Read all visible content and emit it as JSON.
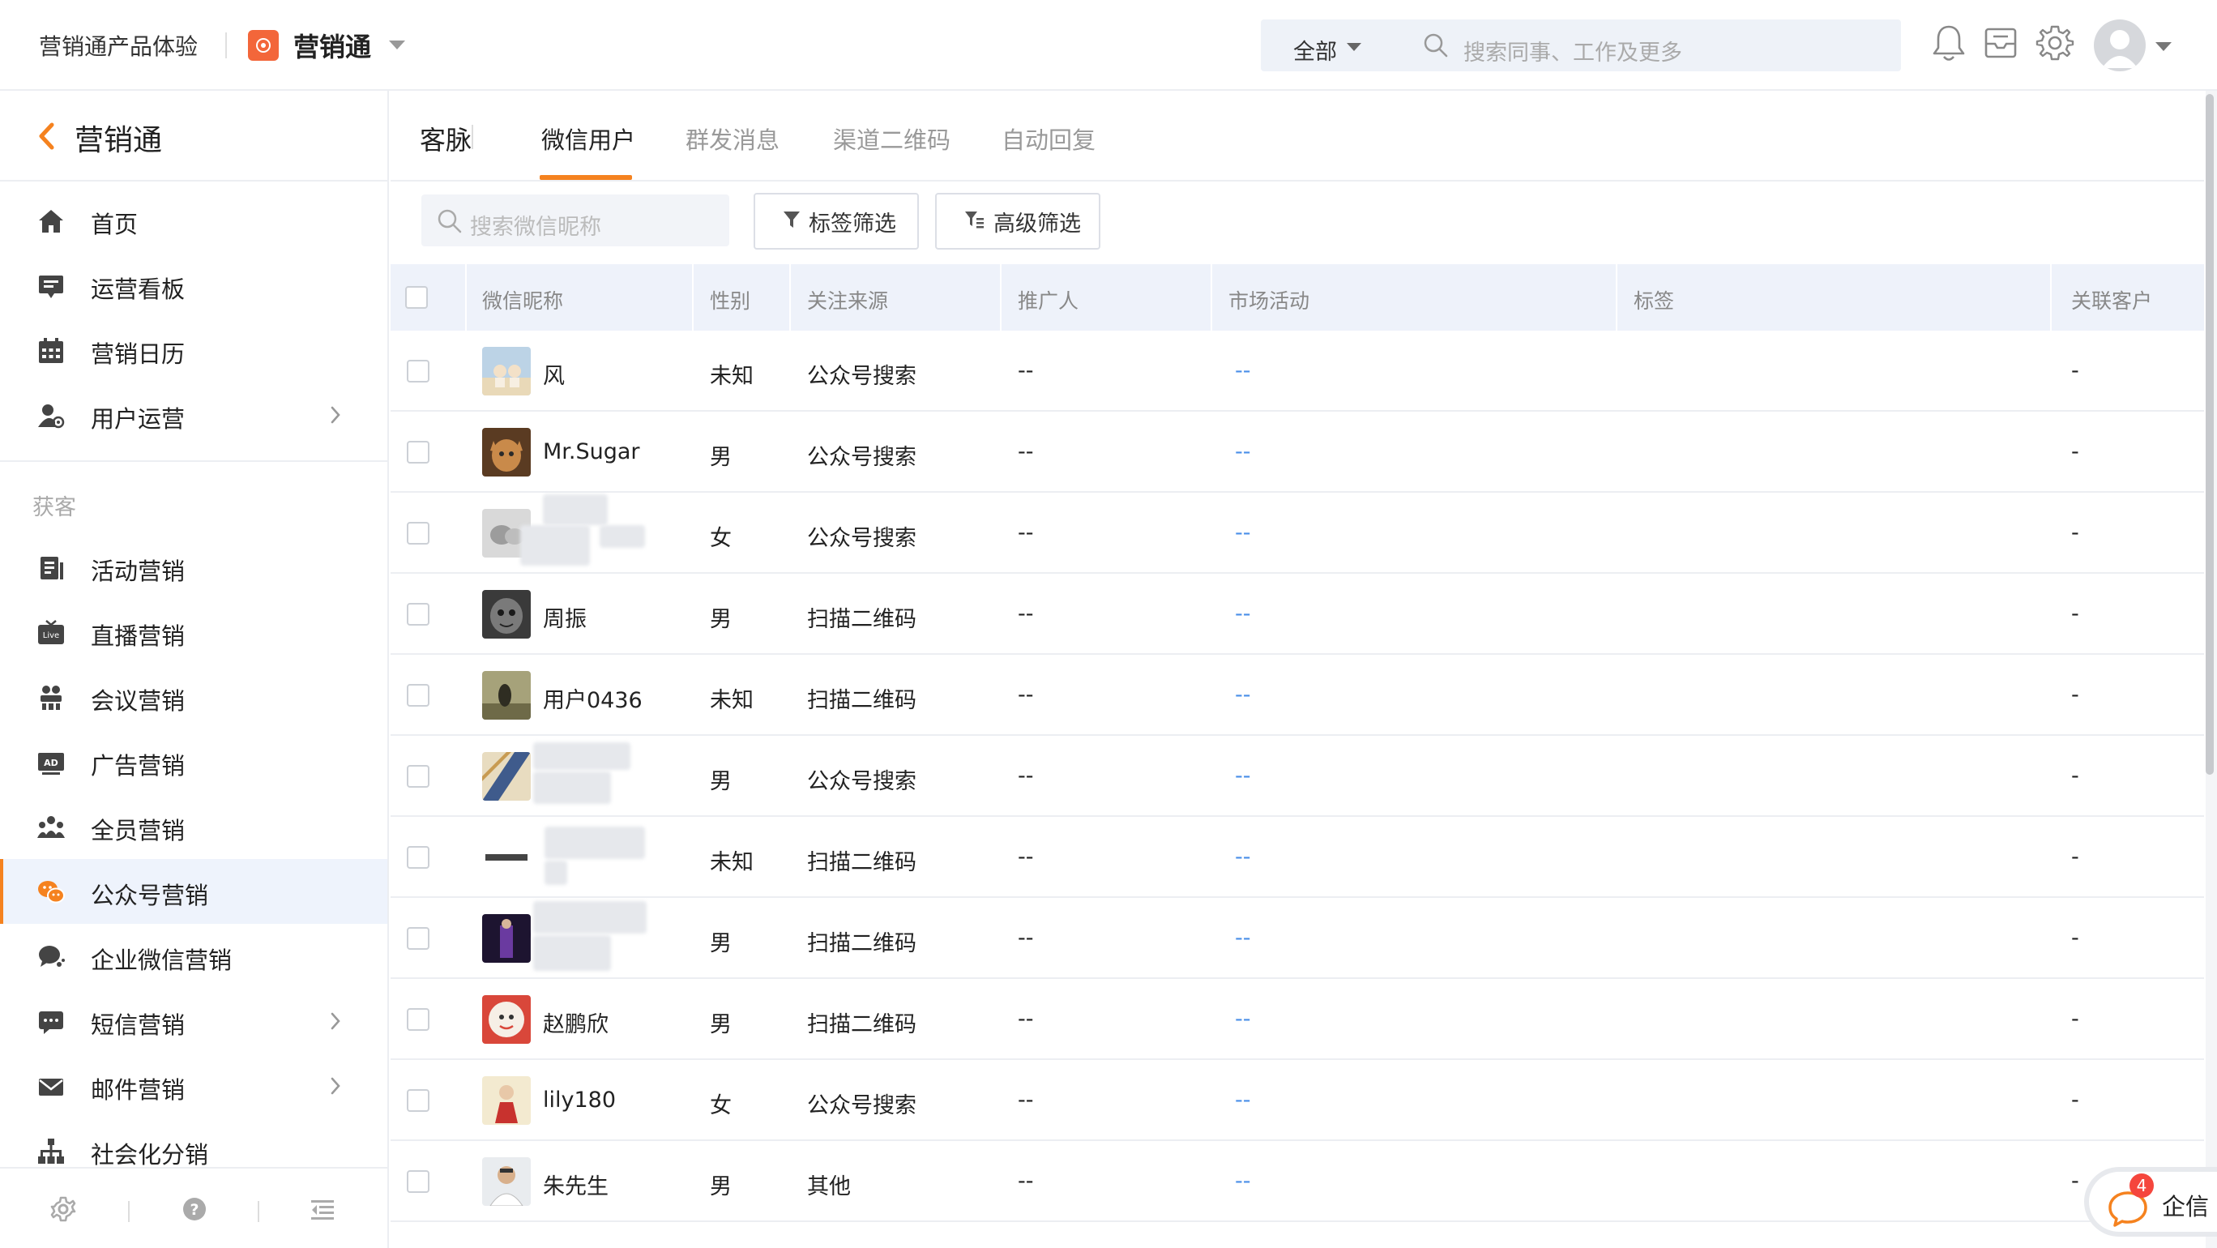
{
  "topbar": {
    "product_name": "营销通产品体验",
    "brand_name": "营销通",
    "search_scope": "全部",
    "search_placeholder": "搜索同事、工作及更多"
  },
  "sidebar": {
    "title": "营销通",
    "items_top": [
      {
        "label": "首页",
        "icon": "home-icon"
      },
      {
        "label": "运营看板",
        "icon": "dashboard-icon"
      },
      {
        "label": "营销日历",
        "icon": "calendar-icon"
      },
      {
        "label": "用户运营",
        "icon": "user-ops-icon",
        "has_children": true
      }
    ],
    "section_label": "获客",
    "items": [
      {
        "label": "活动营销",
        "icon": "activity-icon"
      },
      {
        "label": "直播营销",
        "icon": "live-icon"
      },
      {
        "label": "会议营销",
        "icon": "meeting-icon"
      },
      {
        "label": "广告营销",
        "icon": "ad-icon"
      },
      {
        "label": "全员营销",
        "icon": "team-icon"
      },
      {
        "label": "公众号营销",
        "icon": "wechat-icon",
        "active": true
      },
      {
        "label": "企业微信营销",
        "icon": "wecom-icon"
      },
      {
        "label": "短信营销",
        "icon": "sms-icon",
        "has_children": true
      },
      {
        "label": "邮件营销",
        "icon": "mail-icon",
        "has_children": true
      },
      {
        "label": "社会化分销",
        "icon": "distribution-icon"
      }
    ]
  },
  "tabs": {
    "root": "客脉",
    "items": [
      "微信用户",
      "群发消息",
      "渠道二维码",
      "自动回复"
    ],
    "active_index": 0
  },
  "filters": {
    "search_placeholder": "搜索微信昵称",
    "tag_filter": "标签筛选",
    "advanced_filter": "高级筛选"
  },
  "table": {
    "columns": [
      "微信昵称",
      "性别",
      "关注来源",
      "推广人",
      "市场活动",
      "标签",
      "关联客户"
    ],
    "rows": [
      {
        "nickname": "风",
        "gender": "未知",
        "source": "公众号搜索",
        "promoter": "--",
        "campaign": "--",
        "tags": "",
        "customer": "-"
      },
      {
        "nickname": "Mr.Sugar",
        "gender": "男",
        "source": "公众号搜索",
        "promoter": "--",
        "campaign": "--",
        "tags": "",
        "customer": "-"
      },
      {
        "nickname": "",
        "gender": "女",
        "source": "公众号搜索",
        "promoter": "--",
        "campaign": "--",
        "tags": "",
        "customer": "-"
      },
      {
        "nickname": "周振",
        "gender": "男",
        "source": "扫描二维码",
        "promoter": "--",
        "campaign": "--",
        "tags": "",
        "customer": "-"
      },
      {
        "nickname": "用户0436",
        "gender": "未知",
        "source": "扫描二维码",
        "promoter": "--",
        "campaign": "--",
        "tags": "",
        "customer": "-"
      },
      {
        "nickname": "",
        "gender": "男",
        "source": "公众号搜索",
        "promoter": "--",
        "campaign": "--",
        "tags": "",
        "customer": "-"
      },
      {
        "nickname": "",
        "gender": "未知",
        "source": "扫描二维码",
        "promoter": "--",
        "campaign": "--",
        "tags": "",
        "customer": "-"
      },
      {
        "nickname": "",
        "gender": "男",
        "source": "扫描二维码",
        "promoter": "--",
        "campaign": "--",
        "tags": "",
        "customer": "-"
      },
      {
        "nickname": "赵鹏欣",
        "gender": "男",
        "source": "扫描二维码",
        "promoter": "--",
        "campaign": "--",
        "tags": "",
        "customer": "-"
      },
      {
        "nickname": "lily180",
        "gender": "女",
        "source": "公众号搜索",
        "promoter": "--",
        "campaign": "--",
        "tags": "",
        "customer": "-"
      },
      {
        "nickname": "朱先生",
        "gender": "男",
        "source": "其他",
        "promoter": "--",
        "campaign": "--",
        "tags": "",
        "customer": "-"
      }
    ]
  },
  "qixin": {
    "label": "企信",
    "badge": "4"
  },
  "colors": {
    "accent": "#f5821f",
    "link": "#4a8fe8",
    "brand_logo": "#f3663a",
    "active_bg": "#eef3fc"
  }
}
